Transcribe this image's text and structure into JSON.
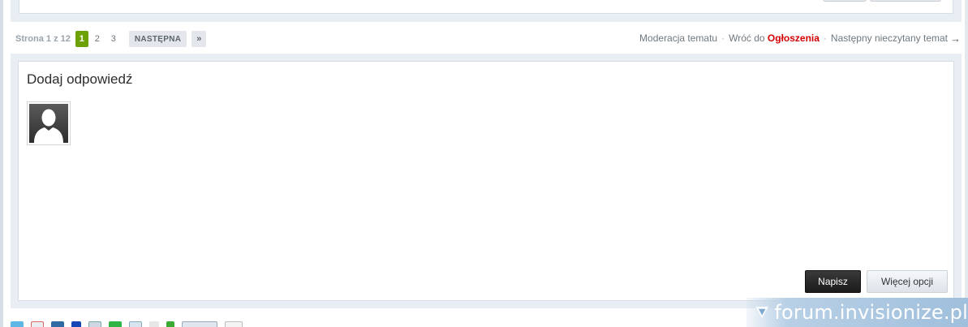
{
  "pagination": {
    "label": "Strona 1 z 12",
    "pages": [
      "1",
      "2",
      "3"
    ],
    "current": "1",
    "next_label": "NASTĘPNA",
    "last_label": "»"
  },
  "topic_links": {
    "moderation": "Moderacja tematu",
    "back_prefix": "Wróć do",
    "forum_name": "Ogłoszenia",
    "next_unread": "Następny nieczytany temat",
    "arrow": "→",
    "forum_color": "#d40000"
  },
  "reply": {
    "title": "Dodaj odpowiedź",
    "submit_label": "Napisz",
    "more_options_label": "Więcej opcji"
  },
  "share_icons": [
    "twitter-icon",
    "google-icon",
    "linkedin-icon",
    "digg-icon",
    "email-icon",
    "evernote-icon",
    "blogger-icon",
    "print-icon",
    "plus-icon",
    "facebook-like-icon",
    "gplus-icon"
  ],
  "watermark": {
    "text": "forum.invisionize.pl"
  },
  "colors": {
    "active_page": "#6ea204",
    "forum_link": "#d40000",
    "submit_button": "#1b1b1b"
  }
}
